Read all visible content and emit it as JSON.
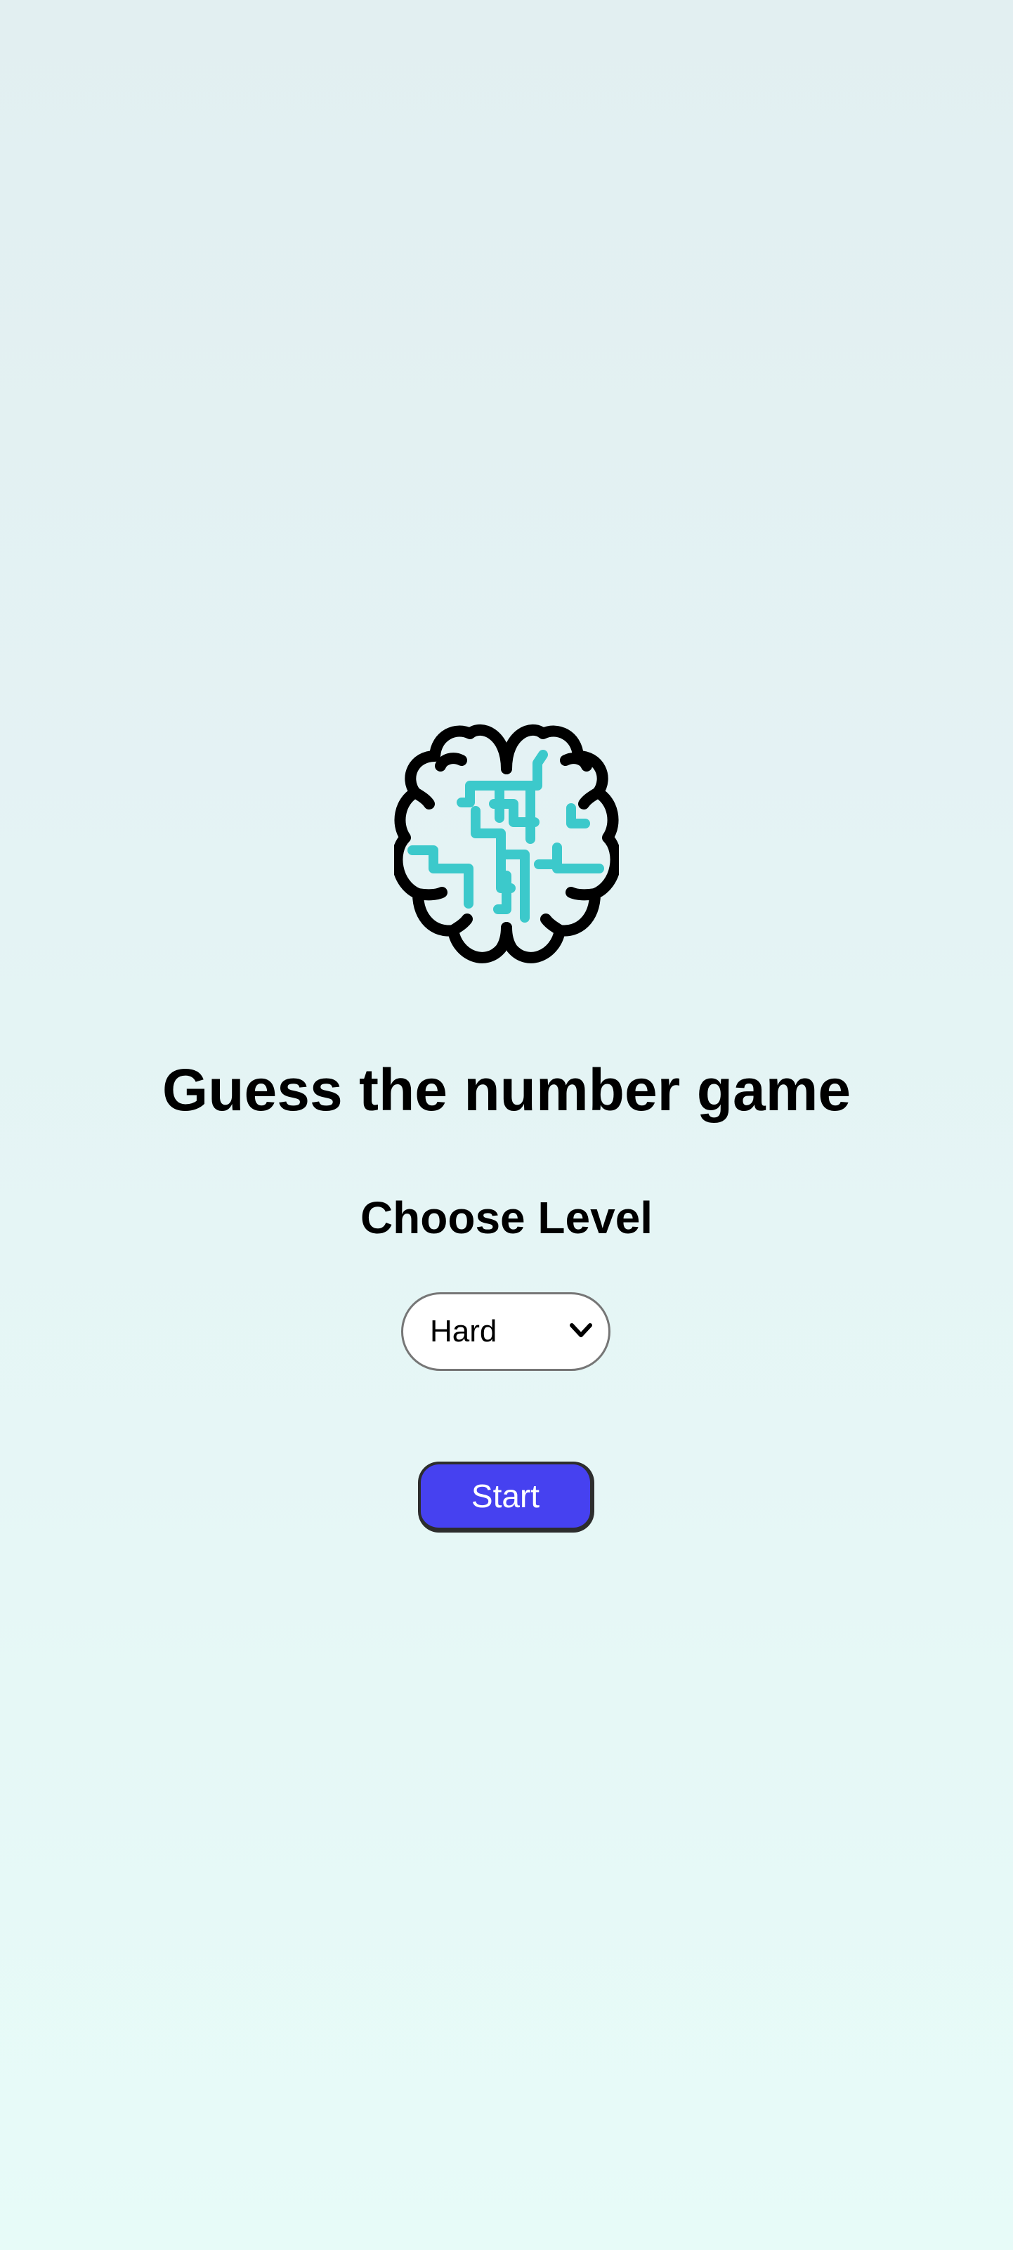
{
  "app": {
    "logo_icon": "brain-maze-icon",
    "title": "Guess the number game"
  },
  "level": {
    "heading": "Choose Level",
    "selected": "Hard",
    "dropdown_icon": "chevron-down-icon"
  },
  "actions": {
    "start_label": "Start"
  },
  "colors": {
    "background_top": "#e2eff1",
    "background_bottom": "#e7fbf8",
    "logo_outline": "#000000",
    "logo_maze": "#3cc9cb",
    "start_button": "#4641f0",
    "start_button_text": "#ffffff",
    "select_border": "#767676"
  }
}
